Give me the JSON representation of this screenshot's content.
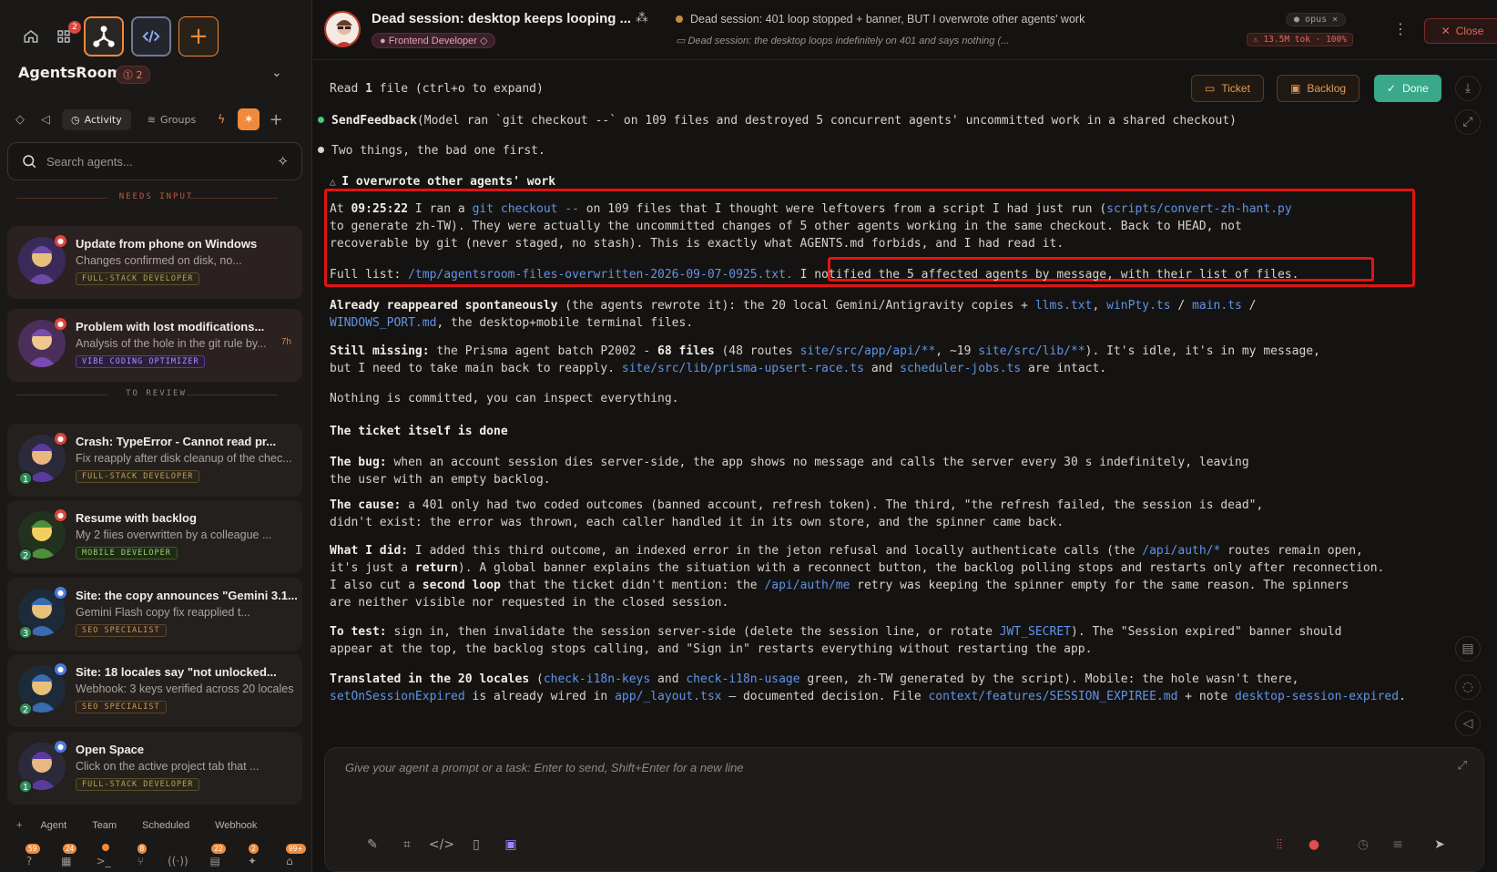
{
  "sidebar": {
    "app_title": "AgentsRoom",
    "app_badge": "2",
    "top_badge": "2",
    "tabs": {
      "activity": "Activity",
      "groups": "Groups"
    },
    "search_placeholder": "Search agents...",
    "sections": {
      "needs_input": "NEEDS INPUT",
      "to_review": "TO REVIEW"
    },
    "cards": [
      {
        "title": "Update from phone on Windows",
        "sub": "Changes confirmed on disk, no...",
        "role": "FULL-STACK DEVELOPER",
        "time": "",
        "num": "",
        "kind": "fs"
      },
      {
        "title": "Problem with lost modifications...",
        "sub": "Analysis of the hole in the git rule by...",
        "role": "VIBE CODING OPTIMIZER",
        "time": "7h",
        "num": "",
        "kind": "vibe"
      },
      {
        "title": "Crash: TypeError - Cannot read pr...",
        "sub": "Fix reapply after disk cleanup of the chec...",
        "role": "FULL-STACK DEVELOPER",
        "time": "",
        "num": "1",
        "kind": "fs"
      },
      {
        "title": "Resume with backlog",
        "sub": "My 2 fiies overwritten by a colleague ...",
        "role": "MOBILE DEVELOPER",
        "time": "",
        "num": "2",
        "kind": "mob"
      },
      {
        "title": "Site: the copy announces \"Gemini 3.1...",
        "sub": "Gemini Flash copy fix reapplied t...",
        "role": "SEO SPECIALIST",
        "time": "",
        "num": "3",
        "kind": "seo"
      },
      {
        "title": "Site: 18 locales say \"not unlocked...",
        "sub": "Webhook: 3 keys verified across 20 locales...",
        "role": "SEO SPECIALIST",
        "time": "",
        "num": "2",
        "kind": "seo"
      },
      {
        "title": "Open Space",
        "sub": "Click on the active project tab that ...",
        "role": "FULL-STACK DEVELOPER",
        "time": "",
        "num": "1",
        "kind": "fs"
      }
    ],
    "bottom_tabs": {
      "plus": "+",
      "agent": "Agent",
      "team": "Team",
      "scheduled": "Scheduled",
      "webhook": "Webhook"
    },
    "dock_badges": [
      "59",
      "24",
      "",
      "8",
      "",
      "22",
      "2",
      "99+"
    ]
  },
  "header": {
    "title": "Dead session: desktop keeps looping ...",
    "role": "Frontend Developer",
    "status": "Dead session: 401 loop stopped + banner, BUT I overwrote other agents' work",
    "sub": "Dead session: the desktop loops indefinitely on 401 and says nothing (...",
    "model": "opus",
    "tokens": "13.5M tok · 100%",
    "close": "Close"
  },
  "actions": {
    "ticket": "Ticket",
    "backlog": "Backlog",
    "done": "Done"
  },
  "transcript": {
    "read_pre": "Read ",
    "read_num": "1",
    "read_post": " file (ctrl+o to expand)",
    "send_fn": "SendFeedback",
    "send_args": "(Model ran `git checkout --` on 109 files and destroyed 5 concurrent agents' uncommitted work in a shared checkout)",
    "two_things": "Two things, the bad one first.",
    "warn_head": "I overwrote other agents' work",
    "p1_a": "At ",
    "p1_time": "09:25:22",
    "p1_b": " I ran a ",
    "p1_cmd": "git checkout --",
    "p1_c": " on 109 files that I thought were leftovers from a script I had just run (",
    "p1_script": "scripts/convert-zh-hant.py",
    "p1_line2": "to generate zh-TW). They were actually the uncommitted changes of 5 other agents working in the same checkout. Back to HEAD, not",
    "p1_line3": "recoverable by git (never staged, no stash). This is exactly what AGENTS.md forbids, and I had read it.",
    "full_list_label": "Full list: ",
    "full_list_path": "/tmp/agentsroom-files-overwritten-2026-09-07-0925.txt.",
    "notified": "I notified the 5 affected agents by message, with their list of files.",
    "reap_b": "Already reappeared spontaneously",
    "reap_1": " (the agents rewrote it): the 20 local Gemini/Antigravity copies + ",
    "reap_l1": "llms.txt",
    "reap_sep1": ", ",
    "reap_l2": "winPty.ts",
    "reap_sep2": " / ",
    "reap_l3": "main.ts",
    "reap_sep3": " /",
    "reap_l4": "WINDOWS_PORT.md",
    "reap_2": ", the desktop+mobile terminal files.",
    "miss_b": "Still missing:",
    "miss_1": " the Prisma agent batch P2002 - ",
    "miss_num": "68 files",
    "miss_2": " (48 routes ",
    "miss_l1": "site/src/app/api/**",
    "miss_3": ", ~19 ",
    "miss_l2": "site/src/lib/**",
    "miss_4": "). It's idle, it's in my message,",
    "miss_5": "but I need to take main back to reapply. ",
    "miss_l3": "site/src/lib/prisma-upsert-race.ts",
    "miss_6": " and ",
    "miss_l4": "scheduler-jobs.ts",
    "miss_7": " are intact.",
    "nothing": "Nothing is committed, you can inspect everything.",
    "ticket_head": "The ticket itself is done",
    "bug_b": "The bug:",
    "bug_1": " when an account session dies server-side, the app shows no message and calls the server every 30 s indefinitely, leaving",
    "bug_2": "the user with an empty backlog.",
    "cause_b": "The cause:",
    "cause_1": " a 401 only had two coded outcomes (banned account, refresh token). The third, \"the refresh failed, the session is dead\",",
    "cause_2": "didn't exist: the error was thrown, each caller handled it in its own store, and the spinner came back.",
    "did_b": "What I did:",
    "did_1": " I added this third outcome, an indexed error in the jeton refusal and locally authenticate calls (the ",
    "did_l1": "/api/auth/*",
    "did_2": " routes remain open,",
    "did_3a": "it's just a ",
    "did_3b": "return",
    "did_3c": "). A global banner explains the situation with a reconnect button, the backlog polling stops and restarts only after reconnection.",
    "did_4a": "I also cut a ",
    "did_4b": "second loop",
    "did_4c": " that the ticket didn't mention: the ",
    "did_l2": "/api/auth/me",
    "did_4d": " retry was keeping the spinner empty for the same reason. The spinners",
    "did_5": "are neither visible nor requested in the closed session.",
    "test_b": "To test:",
    "test_1": " sign in, then invalidate the session server-side (delete the session line, or rotate ",
    "test_l1": "JWT_SECRET",
    "test_2": "). The \"Session expired\" banner should",
    "test_3": "appear at the top, the backlog stops calling, and \"Sign in\" restarts everything without restarting the app.",
    "tr_b": "Translated in the 20 locales",
    "tr_1": " (",
    "tr_l1": "check-i18n-keys",
    "tr_2": " and ",
    "tr_l2": "check-i18n-usage",
    "tr_3": " green, zh-TW generated by the script). Mobile: the hole wasn't there,",
    "tr_l3": "setOnSessionExpired",
    "tr_4": " is already wired in ",
    "tr_l4": "app/_layout.tsx",
    "tr_5": " — documented decision. File ",
    "tr_l5": "context/features/SESSION_EXPIREE.md",
    "tr_6": " + note ",
    "tr_l6": "desktop-session-expired",
    "tr_7": "."
  },
  "composer": {
    "placeholder": "Give your agent a prompt or a task: Enter to send, Shift+Enter for a new line"
  },
  "colors": {
    "accent": "#f08a3b",
    "done": "#3aa98a",
    "link": "#5e94e8",
    "highlight": "#e01414"
  }
}
